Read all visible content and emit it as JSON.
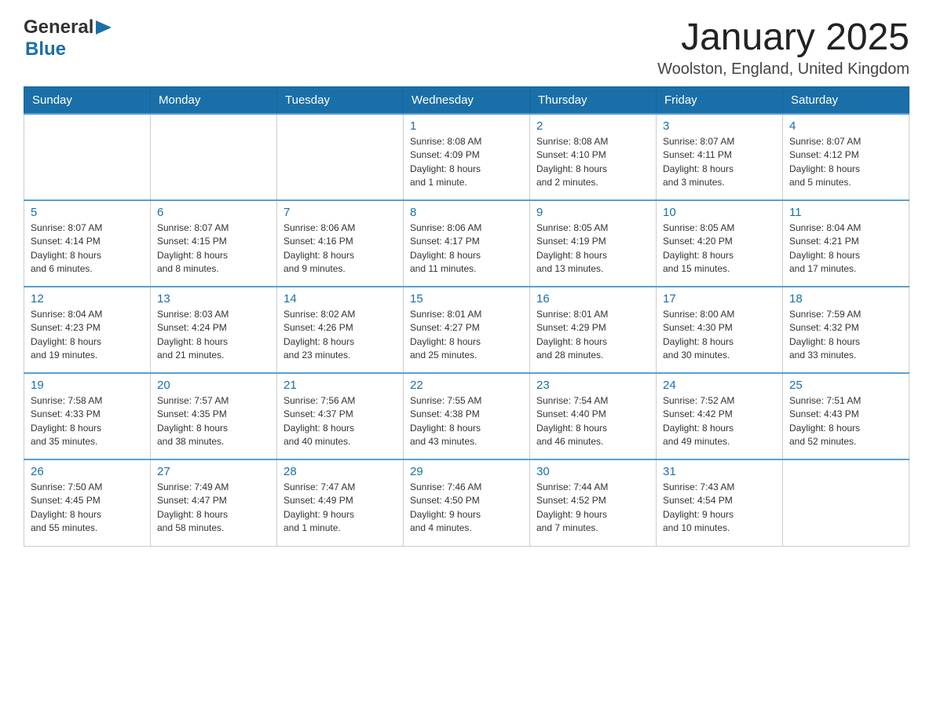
{
  "header": {
    "logo_general": "General",
    "logo_blue": "Blue",
    "title": "January 2025",
    "location": "Woolston, England, United Kingdom"
  },
  "calendar": {
    "days_of_week": [
      "Sunday",
      "Monday",
      "Tuesday",
      "Wednesday",
      "Thursday",
      "Friday",
      "Saturday"
    ],
    "weeks": [
      [
        {
          "day": "",
          "info": ""
        },
        {
          "day": "",
          "info": ""
        },
        {
          "day": "",
          "info": ""
        },
        {
          "day": "1",
          "info": "Sunrise: 8:08 AM\nSunset: 4:09 PM\nDaylight: 8 hours\nand 1 minute."
        },
        {
          "day": "2",
          "info": "Sunrise: 8:08 AM\nSunset: 4:10 PM\nDaylight: 8 hours\nand 2 minutes."
        },
        {
          "day": "3",
          "info": "Sunrise: 8:07 AM\nSunset: 4:11 PM\nDaylight: 8 hours\nand 3 minutes."
        },
        {
          "day": "4",
          "info": "Sunrise: 8:07 AM\nSunset: 4:12 PM\nDaylight: 8 hours\nand 5 minutes."
        }
      ],
      [
        {
          "day": "5",
          "info": "Sunrise: 8:07 AM\nSunset: 4:14 PM\nDaylight: 8 hours\nand 6 minutes."
        },
        {
          "day": "6",
          "info": "Sunrise: 8:07 AM\nSunset: 4:15 PM\nDaylight: 8 hours\nand 8 minutes."
        },
        {
          "day": "7",
          "info": "Sunrise: 8:06 AM\nSunset: 4:16 PM\nDaylight: 8 hours\nand 9 minutes."
        },
        {
          "day": "8",
          "info": "Sunrise: 8:06 AM\nSunset: 4:17 PM\nDaylight: 8 hours\nand 11 minutes."
        },
        {
          "day": "9",
          "info": "Sunrise: 8:05 AM\nSunset: 4:19 PM\nDaylight: 8 hours\nand 13 minutes."
        },
        {
          "day": "10",
          "info": "Sunrise: 8:05 AM\nSunset: 4:20 PM\nDaylight: 8 hours\nand 15 minutes."
        },
        {
          "day": "11",
          "info": "Sunrise: 8:04 AM\nSunset: 4:21 PM\nDaylight: 8 hours\nand 17 minutes."
        }
      ],
      [
        {
          "day": "12",
          "info": "Sunrise: 8:04 AM\nSunset: 4:23 PM\nDaylight: 8 hours\nand 19 minutes."
        },
        {
          "day": "13",
          "info": "Sunrise: 8:03 AM\nSunset: 4:24 PM\nDaylight: 8 hours\nand 21 minutes."
        },
        {
          "day": "14",
          "info": "Sunrise: 8:02 AM\nSunset: 4:26 PM\nDaylight: 8 hours\nand 23 minutes."
        },
        {
          "day": "15",
          "info": "Sunrise: 8:01 AM\nSunset: 4:27 PM\nDaylight: 8 hours\nand 25 minutes."
        },
        {
          "day": "16",
          "info": "Sunrise: 8:01 AM\nSunset: 4:29 PM\nDaylight: 8 hours\nand 28 minutes."
        },
        {
          "day": "17",
          "info": "Sunrise: 8:00 AM\nSunset: 4:30 PM\nDaylight: 8 hours\nand 30 minutes."
        },
        {
          "day": "18",
          "info": "Sunrise: 7:59 AM\nSunset: 4:32 PM\nDaylight: 8 hours\nand 33 minutes."
        }
      ],
      [
        {
          "day": "19",
          "info": "Sunrise: 7:58 AM\nSunset: 4:33 PM\nDaylight: 8 hours\nand 35 minutes."
        },
        {
          "day": "20",
          "info": "Sunrise: 7:57 AM\nSunset: 4:35 PM\nDaylight: 8 hours\nand 38 minutes."
        },
        {
          "day": "21",
          "info": "Sunrise: 7:56 AM\nSunset: 4:37 PM\nDaylight: 8 hours\nand 40 minutes."
        },
        {
          "day": "22",
          "info": "Sunrise: 7:55 AM\nSunset: 4:38 PM\nDaylight: 8 hours\nand 43 minutes."
        },
        {
          "day": "23",
          "info": "Sunrise: 7:54 AM\nSunset: 4:40 PM\nDaylight: 8 hours\nand 46 minutes."
        },
        {
          "day": "24",
          "info": "Sunrise: 7:52 AM\nSunset: 4:42 PM\nDaylight: 8 hours\nand 49 minutes."
        },
        {
          "day": "25",
          "info": "Sunrise: 7:51 AM\nSunset: 4:43 PM\nDaylight: 8 hours\nand 52 minutes."
        }
      ],
      [
        {
          "day": "26",
          "info": "Sunrise: 7:50 AM\nSunset: 4:45 PM\nDaylight: 8 hours\nand 55 minutes."
        },
        {
          "day": "27",
          "info": "Sunrise: 7:49 AM\nSunset: 4:47 PM\nDaylight: 8 hours\nand 58 minutes."
        },
        {
          "day": "28",
          "info": "Sunrise: 7:47 AM\nSunset: 4:49 PM\nDaylight: 9 hours\nand 1 minute."
        },
        {
          "day": "29",
          "info": "Sunrise: 7:46 AM\nSunset: 4:50 PM\nDaylight: 9 hours\nand 4 minutes."
        },
        {
          "day": "30",
          "info": "Sunrise: 7:44 AM\nSunset: 4:52 PM\nDaylight: 9 hours\nand 7 minutes."
        },
        {
          "day": "31",
          "info": "Sunrise: 7:43 AM\nSunset: 4:54 PM\nDaylight: 9 hours\nand 10 minutes."
        },
        {
          "day": "",
          "info": ""
        }
      ]
    ]
  }
}
